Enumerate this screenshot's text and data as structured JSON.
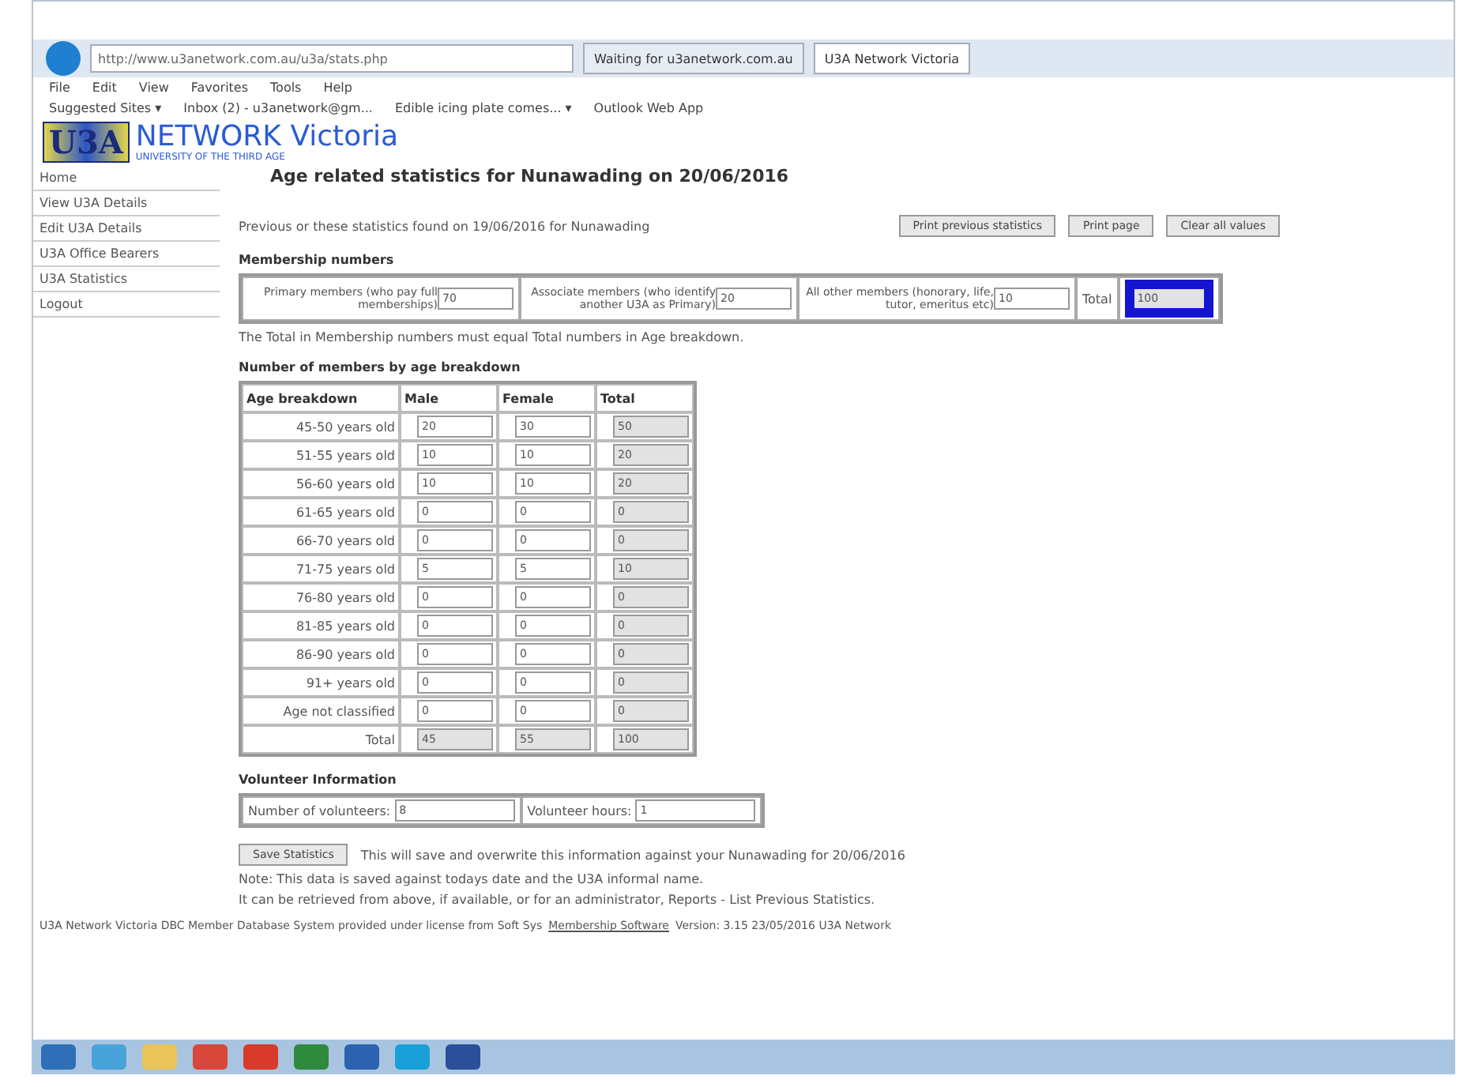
{
  "browser": {
    "address": "http://www.u3anetwork.com.au/u3a/stats.php",
    "tabs": [
      {
        "label": "Waiting for u3anetwork.com.au",
        "selected": false
      },
      {
        "label": "U3A Network Victoria",
        "selected": true
      }
    ],
    "menu": [
      "File",
      "Edit",
      "View",
      "Favorites",
      "Tools",
      "Help"
    ],
    "favorites": [
      "Suggested Sites ▾",
      "Inbox (2) - u3anetwork@gm...",
      "Edible icing plate comes... ▾",
      "Outlook Web App"
    ]
  },
  "logo": {
    "mark": "U3A",
    "title": "NETWORK Victoria",
    "subtitle": "UNIVERSITY OF THE THIRD AGE"
  },
  "sidebar": {
    "items": [
      {
        "label": "Home"
      },
      {
        "label": "View U3A Details"
      },
      {
        "label": "Edit U3A Details"
      },
      {
        "label": "U3A Office Bearers"
      },
      {
        "label": "U3A Statistics"
      },
      {
        "label": "Logout"
      }
    ]
  },
  "title": "Age related statistics for Nunawading on 20/06/2016",
  "previous_note": "Previous or these statistics found on 19/06/2016 for Nunawading",
  "buttons": [
    "Print previous statistics",
    "Print page",
    "Clear all values"
  ],
  "membership": {
    "heading": "Membership numbers",
    "fields": [
      {
        "label": "Primary members (who pay full memberships)",
        "value": "70"
      },
      {
        "label": "Associate members (who identify another U3A as Primary)",
        "value": "20"
      },
      {
        "label": "All other members (honorary, life, tutor, emeritus etc)",
        "value": "10"
      }
    ],
    "total_label": "Total",
    "total": "100",
    "total_highlighted": true,
    "note": "The Total in Membership numbers must equal Total numbers in Age breakdown."
  },
  "age": {
    "heading": "Number of members by age breakdown",
    "columns": [
      "Age breakdown",
      "Male",
      "Female",
      "Total"
    ],
    "rows": [
      {
        "label": "45-50 years old",
        "male": "20",
        "female": "30",
        "total": "50"
      },
      {
        "label": "51-55 years old",
        "male": "10",
        "female": "10",
        "total": "20"
      },
      {
        "label": "56-60 years old",
        "male": "10",
        "female": "10",
        "total": "20"
      },
      {
        "label": "61-65 years old",
        "male": "0",
        "female": "0",
        "total": "0"
      },
      {
        "label": "66-70 years old",
        "male": "0",
        "female": "0",
        "total": "0"
      },
      {
        "label": "71-75 years old",
        "male": "5",
        "female": "5",
        "total": "10"
      },
      {
        "label": "76-80 years old",
        "male": "0",
        "female": "0",
        "total": "0"
      },
      {
        "label": "81-85 years old",
        "male": "0",
        "female": "0",
        "total": "0"
      },
      {
        "label": "86-90 years old",
        "male": "0",
        "female": "0",
        "total": "0"
      },
      {
        "label": "91+ years old",
        "male": "0",
        "female": "0",
        "total": "0"
      },
      {
        "label": "Age not classified",
        "male": "0",
        "female": "0",
        "total": "0"
      }
    ],
    "total": {
      "label": "Total",
      "male": "45",
      "female": "55",
      "total": "100"
    }
  },
  "volunteers": {
    "heading": "Volunteer Information",
    "fields": [
      {
        "label": "Number of volunteers:",
        "value": "8"
      },
      {
        "label": "Volunteer hours:",
        "value": "1"
      }
    ]
  },
  "save": {
    "button": "Save Statistics",
    "text": "This will save and overwrite this information against your Nunawading for 20/06/2016",
    "notes": [
      "Note: This data is saved against todays date and the U3A informal name.",
      "It can be retrieved from above, if available, or for an administrator, Reports - List Previous Statistics."
    ]
  },
  "footer": {
    "text": "U3A Network Victoria DBC Member Database System provided under license from Soft Sys",
    "link": "Membership Software",
    "version": "Version: 3.15 23/05/2016 U3A Network"
  },
  "taskbar": {
    "apps": [
      {
        "color": "#2f6fb7"
      },
      {
        "color": "#4aa3d8"
      },
      {
        "color": "#e8c45a"
      },
      {
        "color": "#d9473b"
      },
      {
        "color": "#d93a2b"
      },
      {
        "color": "#2e8b3e"
      },
      {
        "color": "#2b63b0"
      },
      {
        "color": "#1aa0d8"
      },
      {
        "color": "#2b4f9a"
      }
    ]
  }
}
